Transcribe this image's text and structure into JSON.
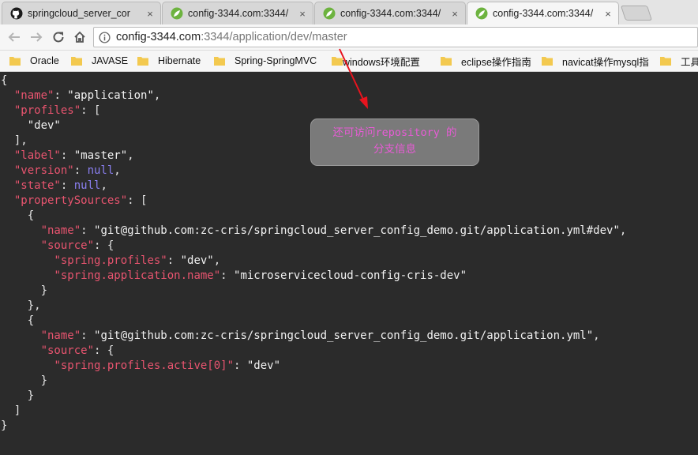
{
  "tabs": [
    {
      "title": "springcloud_server_cor",
      "favicon": "github-icon",
      "active": false
    },
    {
      "title": "config-3344.com:3344/",
      "favicon": "spring-leaf-icon",
      "active": false
    },
    {
      "title": "config-3344.com:3344/",
      "favicon": "spring-leaf-icon",
      "active": false
    },
    {
      "title": "config-3344.com:3344/",
      "favicon": "spring-leaf-icon",
      "active": true
    }
  ],
  "tab_close_glyph": "×",
  "address": {
    "host": "config-3344.com",
    "rest": ":3344/application/dev/master"
  },
  "bookmarks": [
    "Oracle",
    "JAVASE",
    "Hibernate",
    "Spring-SpringMVC",
    "windows环境配置",
    "eclipse操作指南",
    "navicat操作mysql指",
    "工具"
  ],
  "json": {
    "name_key": "\"name\"",
    "name_val": "\"application\"",
    "profiles_key": "\"profiles\"",
    "profile_0": "\"dev\"",
    "label_key": "\"label\"",
    "label_val": "\"master\"",
    "version_key": "\"version\"",
    "version_val": "null",
    "state_key": "\"state\"",
    "state_val": "null",
    "ps_key": "\"propertySources\"",
    "ps0_name_key": "\"name\"",
    "ps0_name_val": "\"git@github.com:zc-cris/springcloud_server_config_demo.git/application.yml#dev\"",
    "ps0_source_key": "\"source\"",
    "ps0_k1": "\"spring.profiles\"",
    "ps0_v1": "\"dev\"",
    "ps0_k2": "\"spring.application.name\"",
    "ps0_v2": "\"microservicecloud-config-cris-dev\"",
    "ps1_name_key": "\"name\"",
    "ps1_name_val": "\"git@github.com:zc-cris/springcloud_server_config_demo.git/application.yml\"",
    "ps1_source_key": "\"source\"",
    "ps1_k1": "\"spring.profiles.active[0]\"",
    "ps1_v1": "\"dev\""
  },
  "annotation": {
    "line1": "还可访问repository 的",
    "line2": "分支信息",
    "color": "#e85bd6",
    "arrow_color": "#e8141e"
  }
}
